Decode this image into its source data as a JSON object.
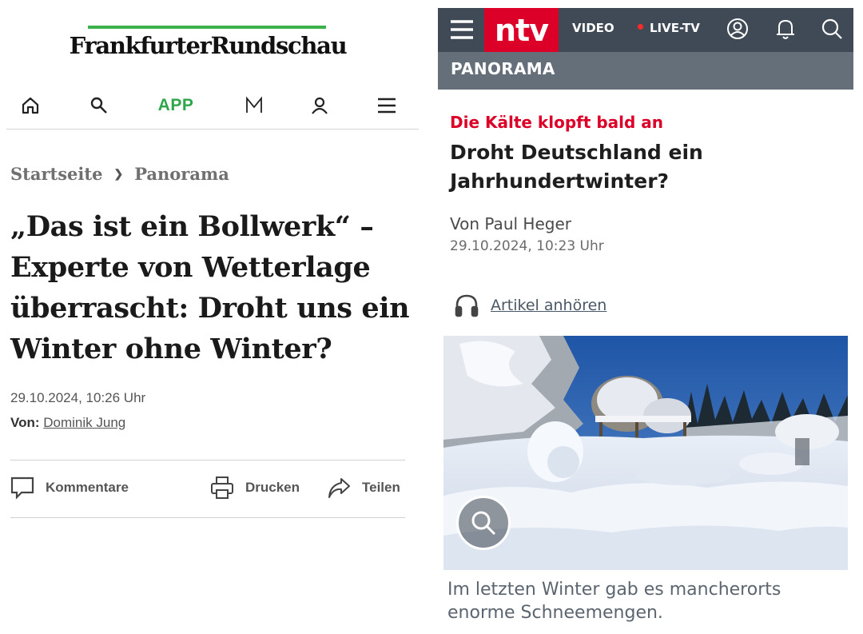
{
  "fr": {
    "logo": "FrankfurterRundschau",
    "nav": {
      "home_icon": "home-icon",
      "search_icon": "search-icon",
      "app_label": "APP",
      "m_icon": "m-logo-icon",
      "user_icon": "user-icon",
      "menu_icon": "hamburger-menu-icon"
    },
    "breadcrumb": {
      "home": "Startseite",
      "separator": "❯",
      "section": "Panorama"
    },
    "headline": [
      "„Das ist ein Bollwerk“ –",
      "Experte von Wetterlage",
      "überrascht: Droht uns ein",
      "Winter ohne Winter?"
    ],
    "date": "29.10.2024, 10:26 Uhr",
    "author_prefix": "Von:",
    "author_name": "Dominik Jung",
    "actions": {
      "comments": "Kommentare",
      "print": "Drucken",
      "share": "Teilen"
    },
    "colors": {
      "accent_green": "#3bb24a"
    }
  },
  "ntv": {
    "brand": "ntv",
    "topbar": {
      "video": "VIDEO",
      "live": "LIVE-TV"
    },
    "icons": [
      "hamburger-menu-icon",
      "account-icon",
      "bell-icon",
      "search-icon"
    ],
    "section": "PANORAMA",
    "kicker": "Die Kälte klopft bald an",
    "title": [
      "Droht Deutschland ein",
      "Jahrhundertwinter?"
    ],
    "author": "Von Paul Heger",
    "date": "29.10.2024, 10:23 Uhr",
    "listen": "Artikel anhören",
    "caption": [
      "Im letzten Winter gab es mancherorts",
      "enorme Schneemengen."
    ],
    "colors": {
      "brand_red": "#dc0028",
      "topbar": "#3f4a56",
      "section": "#646f7a"
    }
  }
}
